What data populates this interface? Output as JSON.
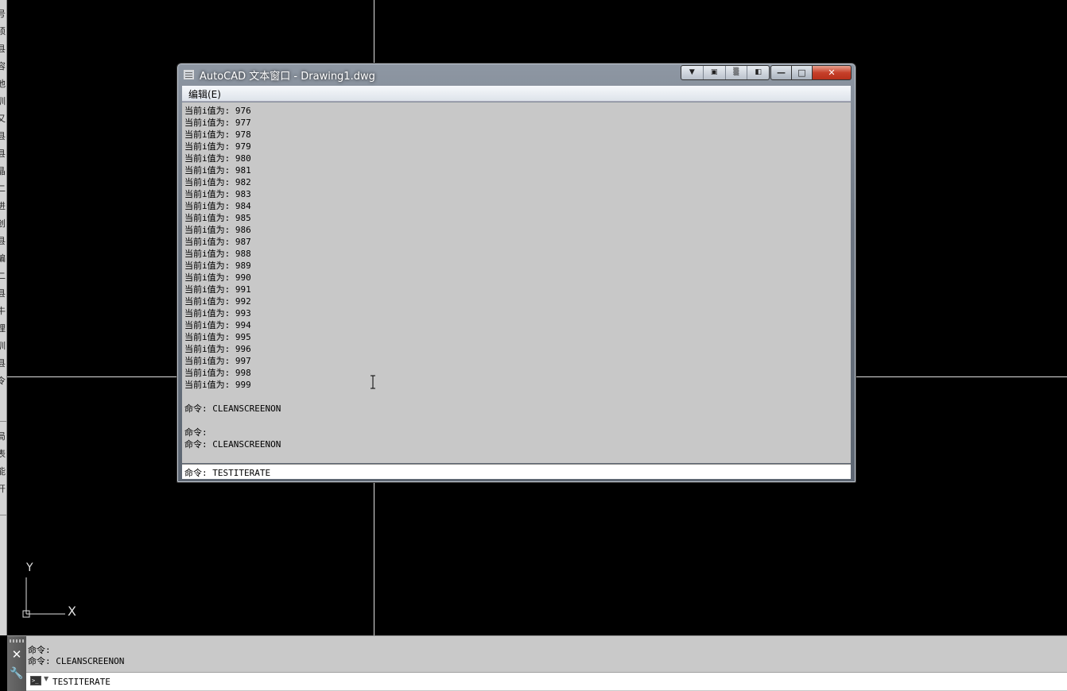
{
  "left_strip": {
    "glyphs": [
      "号",
      "硕",
      "县",
      "容",
      "池",
      "训",
      "又",
      "县",
      "县",
      "晶",
      "二",
      "进",
      "创",
      "县",
      "编",
      "二",
      "县",
      "牛",
      "理",
      "训",
      "县",
      "令",
      "局",
      "表",
      "能",
      "开"
    ]
  },
  "text_window": {
    "title": "AutoCAD 文本窗口 - Drawing1.dwg",
    "menu": {
      "edit": "编辑(E)"
    },
    "toolbar_icons": [
      "chevron-down-icon",
      "properties-icon",
      "transparency-icon",
      "pin-icon"
    ],
    "window_buttons": {
      "minimize": "—",
      "maximize": "□",
      "close": "✕"
    },
    "history_lines": [
      "当前i值为: 976",
      "当前i值为: 977",
      "当前i值为: 978",
      "当前i值为: 979",
      "当前i值为: 980",
      "当前i值为: 981",
      "当前i值为: 982",
      "当前i值为: 983",
      "当前i值为: 984",
      "当前i值为: 985",
      "当前i值为: 986",
      "当前i值为: 987",
      "当前i值为: 988",
      "当前i值为: 989",
      "当前i值为: 990",
      "当前i值为: 991",
      "当前i值为: 992",
      "当前i值为: 993",
      "当前i值为: 994",
      "当前i值为: 995",
      "当前i值为: 996",
      "当前i值为: 997",
      "当前i值为: 998",
      "当前i值为: 999",
      "",
      "命令: CLEANSCREENON",
      "",
      "命令:",
      "命令: CLEANSCREENON"
    ],
    "command_line": "命令: TESTITERATE"
  },
  "ucs": {
    "x_label": "X",
    "y_label": "Y"
  },
  "command_window": {
    "history": [
      "命令:",
      "命令: CLEANSCREENON"
    ],
    "input_value": "TESTITERATE",
    "close_glyph": "✕",
    "wrench_glyph": "🔧",
    "prompt_glyph": ">_",
    "prompt_arrow": "▼"
  }
}
